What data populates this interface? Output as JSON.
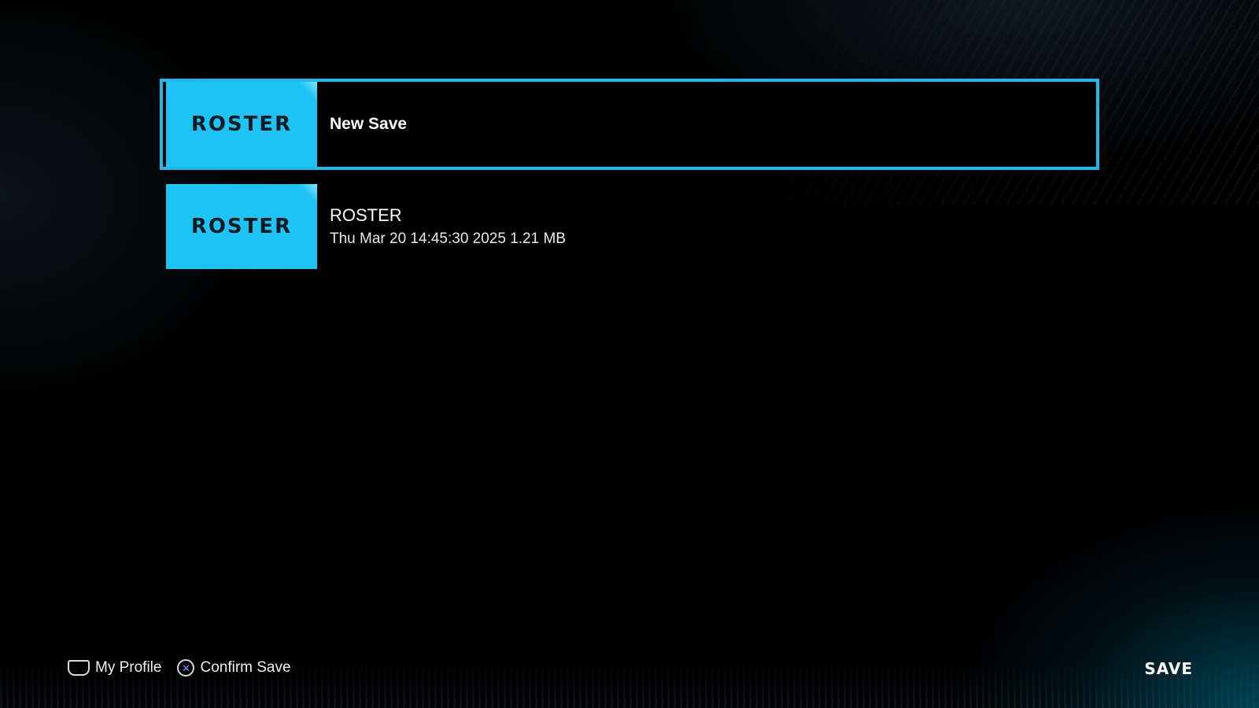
{
  "screen": {
    "title": "SAVE"
  },
  "saves": [
    {
      "thumbnail_label": "ROSTER",
      "title": "New Save",
      "meta": "",
      "selected": true
    },
    {
      "thumbnail_label": "ROSTER",
      "title": "ROSTER",
      "meta": "Thu Mar 20 14:45:30 2025 1.21 MB",
      "selected": false
    }
  ],
  "footer": {
    "hints": [
      {
        "icon": "touchpad-icon",
        "label": "My Profile"
      },
      {
        "icon": "cross-button-icon",
        "glyph": "✕",
        "label": "Confirm Save"
      }
    ]
  },
  "colors": {
    "accent": "#1fb8e8",
    "thumbnail": "#1cc4f6",
    "background": "#000000"
  }
}
